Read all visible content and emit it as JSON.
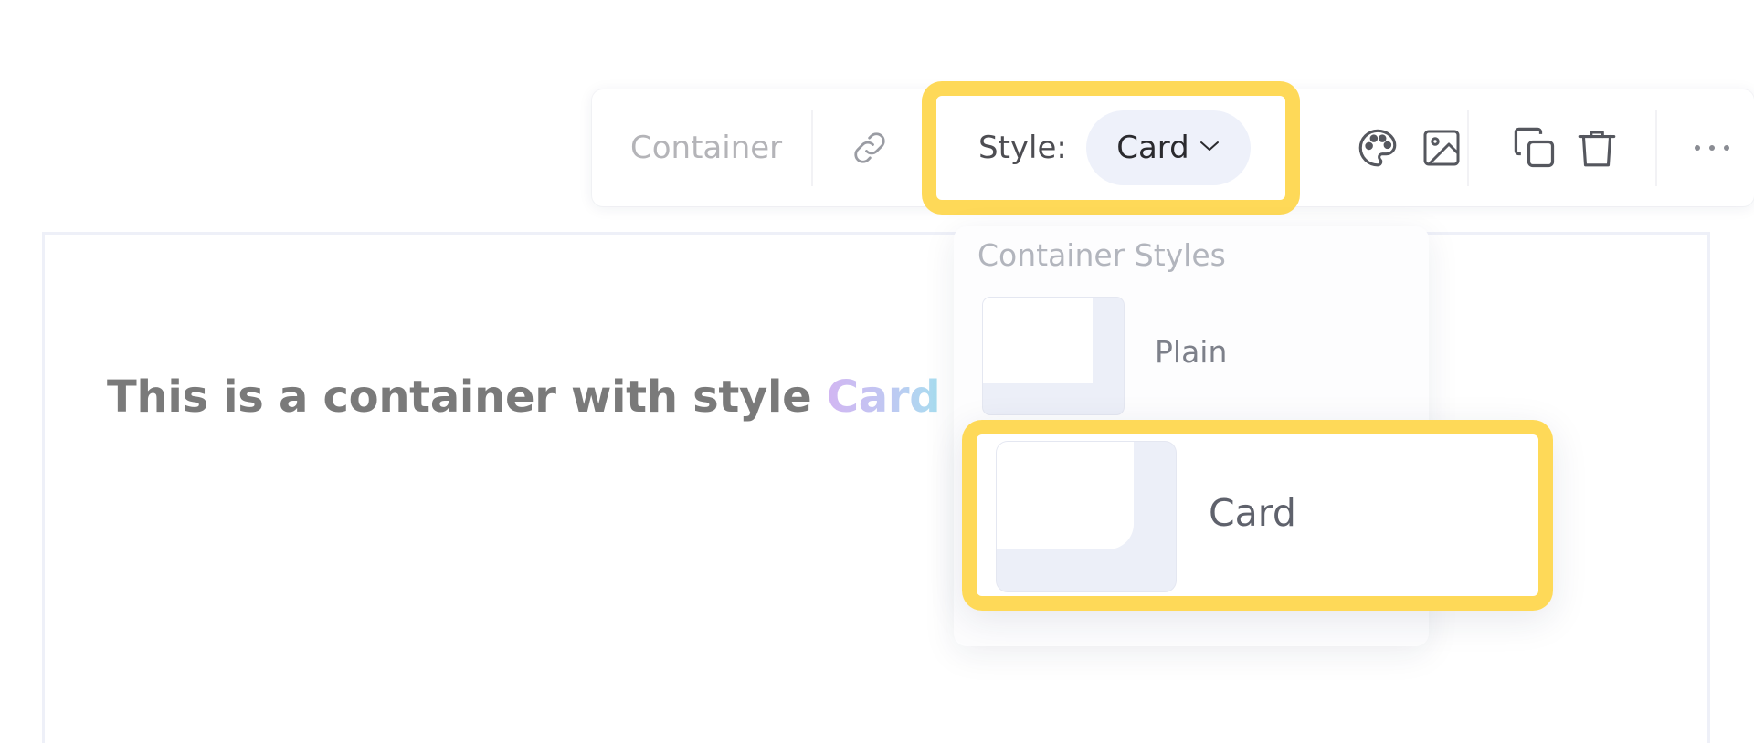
{
  "content": {
    "heading_prefix": "This is a container with style ",
    "heading_accent": "Card"
  },
  "toolbar": {
    "block_label": "Container",
    "style_label": "Style:",
    "style_value": "Card",
    "icons": [
      "link-icon",
      "chevron-down-icon",
      "palette-icon",
      "image-icon",
      "duplicate-icon",
      "trash-icon",
      "more-icon"
    ]
  },
  "dropdown": {
    "title": "Container Styles",
    "options": [
      {
        "label": "Plain",
        "selected": false
      },
      {
        "label": "Card",
        "selected": true
      }
    ]
  },
  "colors": {
    "highlight": "#fed958",
    "select_bg": "#eef1fa",
    "heading_text": "#7a7a7a",
    "accent_gradient": [
      "#d2b6f2",
      "#a8def0"
    ]
  }
}
